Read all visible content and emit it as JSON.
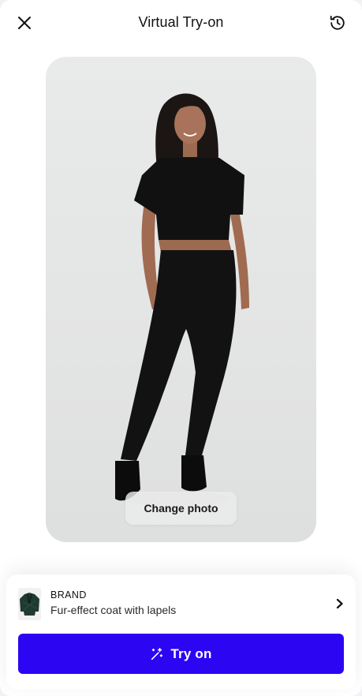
{
  "header": {
    "title": "Virtual Try-on",
    "close_icon": "close-icon",
    "history_icon": "history-icon"
  },
  "photo": {
    "change_photo_label": "Change photo"
  },
  "product": {
    "brand": "BRAND",
    "name": "Fur-effect coat with lapels",
    "chevron_icon": "chevron-right-icon"
  },
  "cta": {
    "label": "Try on",
    "icon": "magic-wand-icon",
    "color": "#2c06f3"
  }
}
